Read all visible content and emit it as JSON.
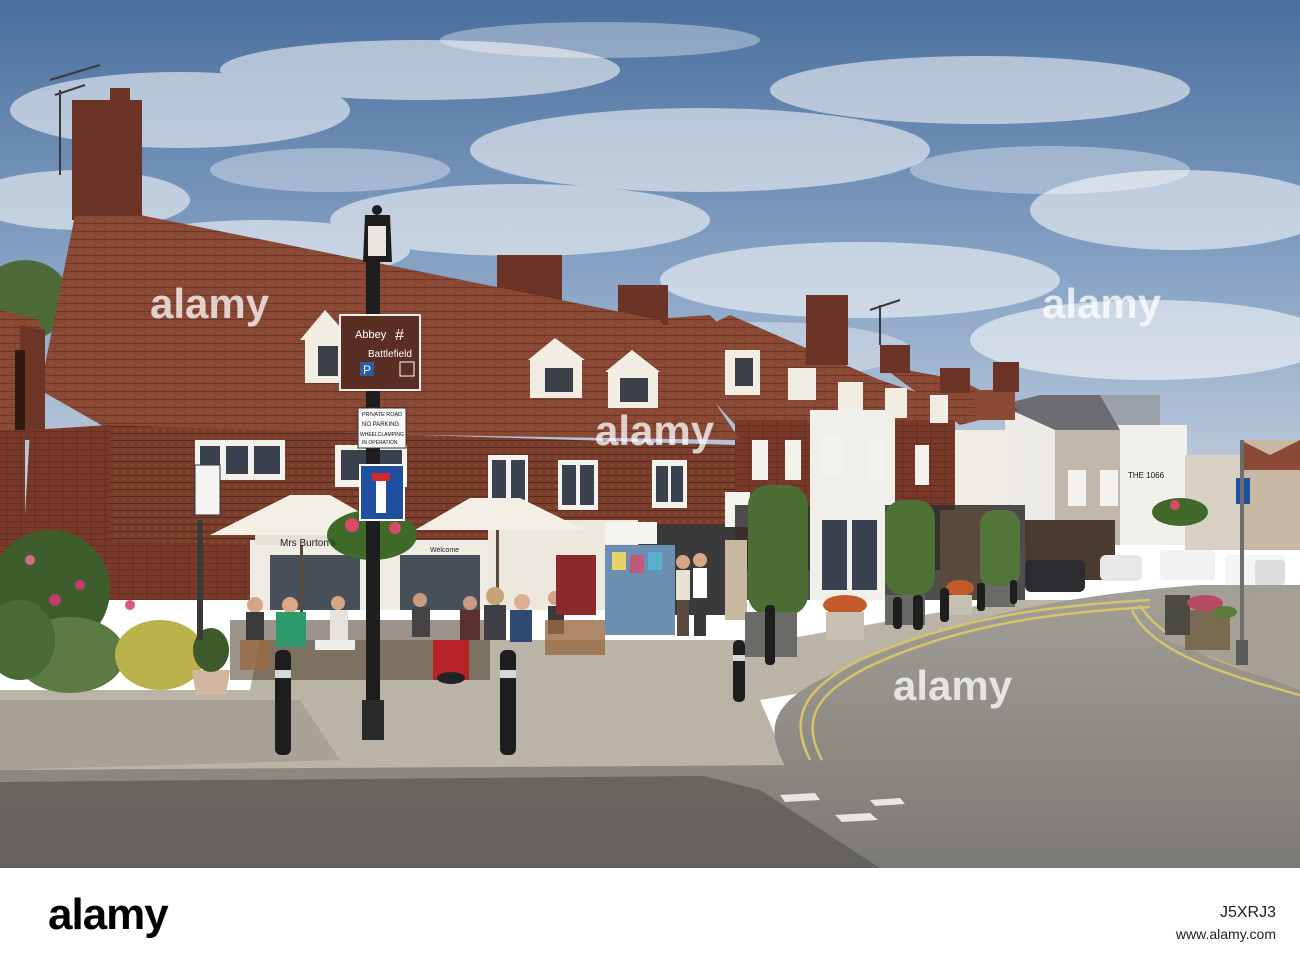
{
  "watermark": {
    "brand": "alamy",
    "image_id": "J5XRJ3",
    "footer_url": "www.alamy.com"
  },
  "signs": {
    "direction_line1": "Abbey",
    "direction_line2": "Battlefield",
    "parking": "P",
    "notice_line1": "PRIVATE ROAD",
    "notice_line2": "NO PARKING",
    "notice_line3": "WHEELCLAMPING",
    "notice_line4": "IN OPERATION"
  },
  "storefronts": {
    "cafe_name": "Mrs Burton's",
    "welcome": "Welcome",
    "building_name": "THE 1066"
  },
  "colors": {
    "sky": "#6f8fb8",
    "roof_tiles": "#8a4a36",
    "brick": "#7a3a2a",
    "pavement": "#b9b4a8",
    "road": "#8e8b84",
    "sign_brown": "#5a2e22",
    "umbrella": "#f3efe4"
  }
}
